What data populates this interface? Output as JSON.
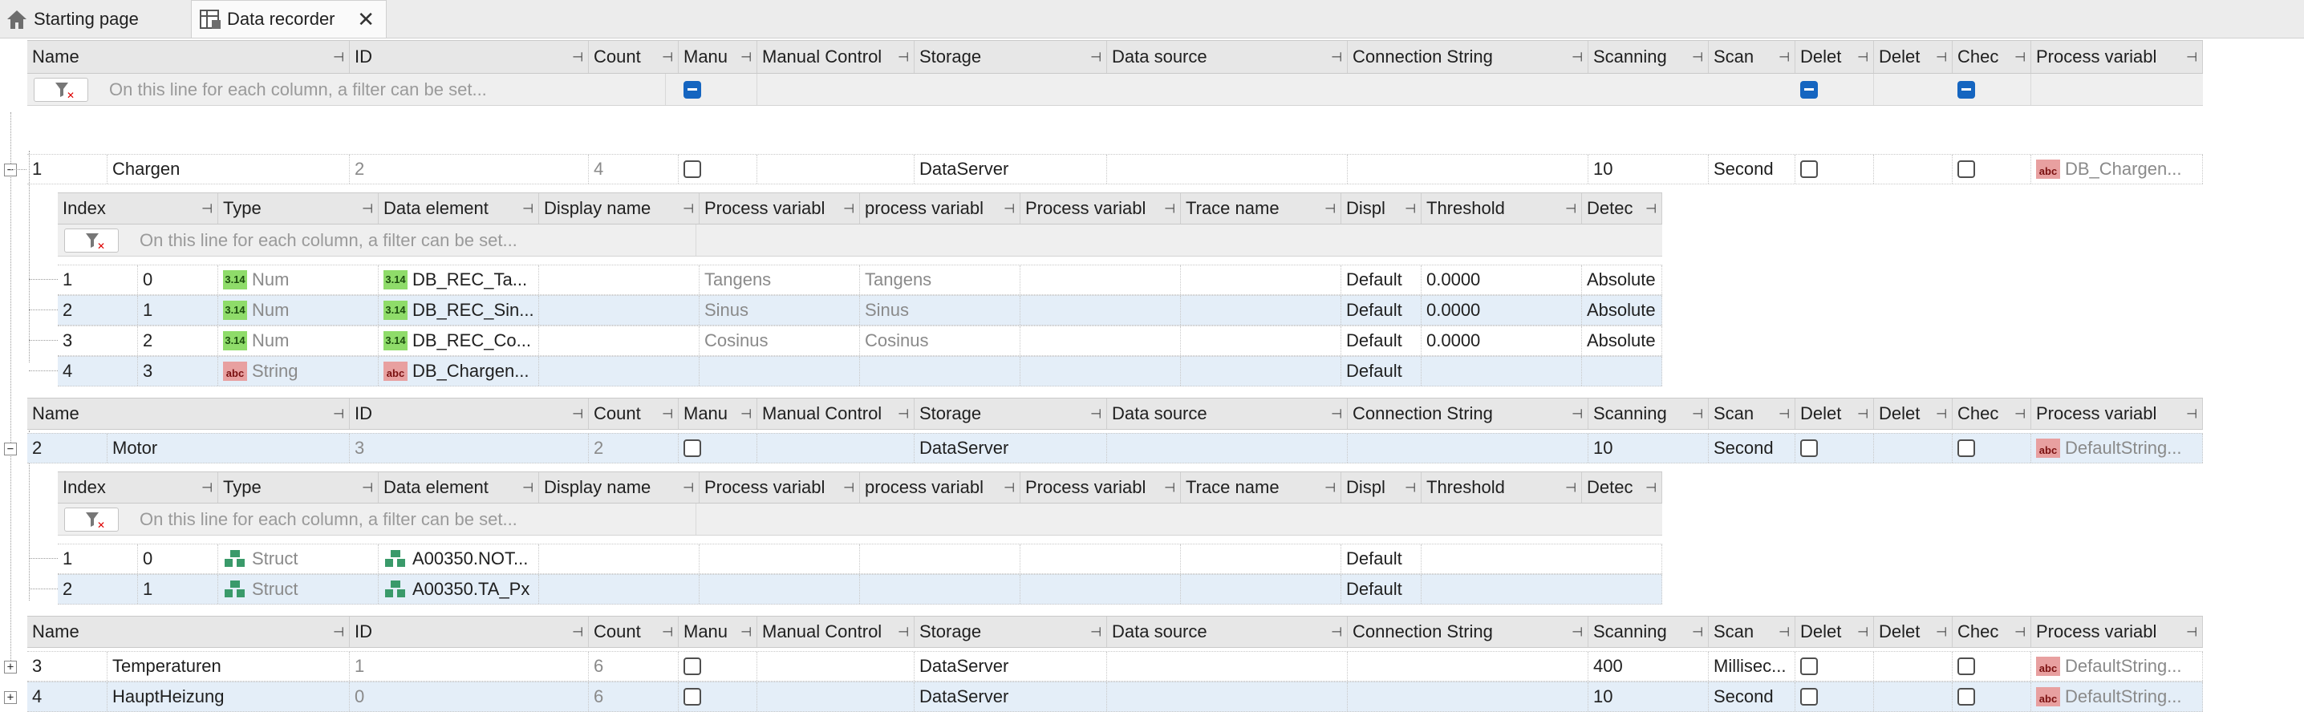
{
  "tabs": [
    {
      "label": "Starting page",
      "icon": "home-icon"
    },
    {
      "label": "Data recorder",
      "icon": "data-recorder-icon",
      "close": "✕"
    }
  ],
  "main_columns": [
    "Name",
    "ID",
    "Count",
    "Manu",
    "Manual Control",
    "Storage",
    "Data source",
    "Connection String",
    "Scanning",
    "Scan",
    "Delet",
    "Delet",
    "Chec",
    "Process variabl"
  ],
  "sub_columns": [
    "Index",
    "Type",
    "Data element",
    "Display name",
    "Process variabl",
    "process variabl",
    "Process variabl",
    "Trace name",
    "Displ",
    "Threshold",
    "Detec"
  ],
  "filter_placeholder": "On this line for each column, a filter can be set...",
  "recorders": [
    {
      "row": "1",
      "name": "Chargen",
      "id": "2",
      "count": "4",
      "storage": "DataServer",
      "scanning": "10",
      "scan": "Second",
      "pv": "DB_Chargen...",
      "children": [
        {
          "row": "1",
          "index": "0",
          "type": "Num",
          "element": "DB_REC_Ta...",
          "pv1": "Tangens",
          "pv2": "Tangens",
          "displ": "Default",
          "threshold": "0.0000",
          "detec": "Absolute"
        },
        {
          "row": "2",
          "index": "1",
          "type": "Num",
          "element": "DB_REC_Sin...",
          "pv1": "Sinus",
          "pv2": "Sinus",
          "displ": "Default",
          "threshold": "0.0000",
          "detec": "Absolute"
        },
        {
          "row": "3",
          "index": "2",
          "type": "Num",
          "element": "DB_REC_Co...",
          "pv1": "Cosinus",
          "pv2": "Cosinus",
          "displ": "Default",
          "threshold": "0.0000",
          "detec": "Absolute"
        },
        {
          "row": "4",
          "index": "3",
          "type": "String",
          "element": "DB_Chargen...",
          "pv1": "",
          "pv2": "",
          "displ": "Default",
          "threshold": "",
          "detec": ""
        }
      ]
    },
    {
      "row": "2",
      "name": "Motor",
      "id": "3",
      "count": "2",
      "storage": "DataServer",
      "scanning": "10",
      "scan": "Second",
      "pv": "DefaultString...",
      "children": [
        {
          "row": "1",
          "index": "0",
          "type": "Struct",
          "element": "A00350.NOT...",
          "displ": "Default"
        },
        {
          "row": "2",
          "index": "1",
          "type": "Struct",
          "element": "A00350.TA_Px",
          "displ": "Default"
        }
      ]
    },
    {
      "row": "3",
      "name": "Temperaturen",
      "id": "1",
      "count": "6",
      "storage": "DataServer",
      "scanning": "400",
      "scan": "Millisec...",
      "pv": "DefaultString..."
    },
    {
      "row": "4",
      "name": "HauptHeizung",
      "id": "0",
      "count": "6",
      "storage": "DataServer",
      "scanning": "10",
      "scan": "Second",
      "pv": "DefaultString..."
    }
  ],
  "icon_text": {
    "num": "3.14",
    "abc": "abc"
  },
  "colors": {
    "accent": "#1565c0",
    "row_alt": "#e4eef8",
    "header": "#e7e7e7"
  }
}
